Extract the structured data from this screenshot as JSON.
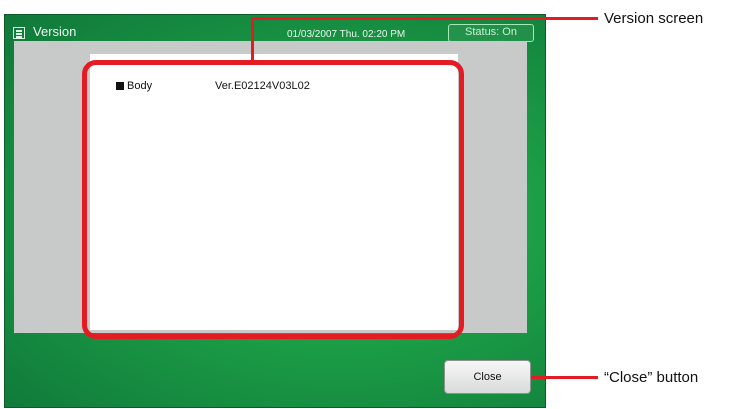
{
  "window": {
    "title": "Version",
    "datetime": "01/03/2007 Thu. 02:20 PM",
    "status": "Status: On"
  },
  "version_info": {
    "label": "Body",
    "value": "Ver.E02124V03L02"
  },
  "buttons": {
    "close": "Close"
  },
  "annotations": {
    "version_screen": "Version screen",
    "close_button": "“Close” button"
  },
  "colors": {
    "panel_green": "#1b9c45",
    "highlight_red": "#e31b23"
  },
  "icons": {
    "title_icon": "window-icon",
    "bullet": "square-bullet"
  }
}
